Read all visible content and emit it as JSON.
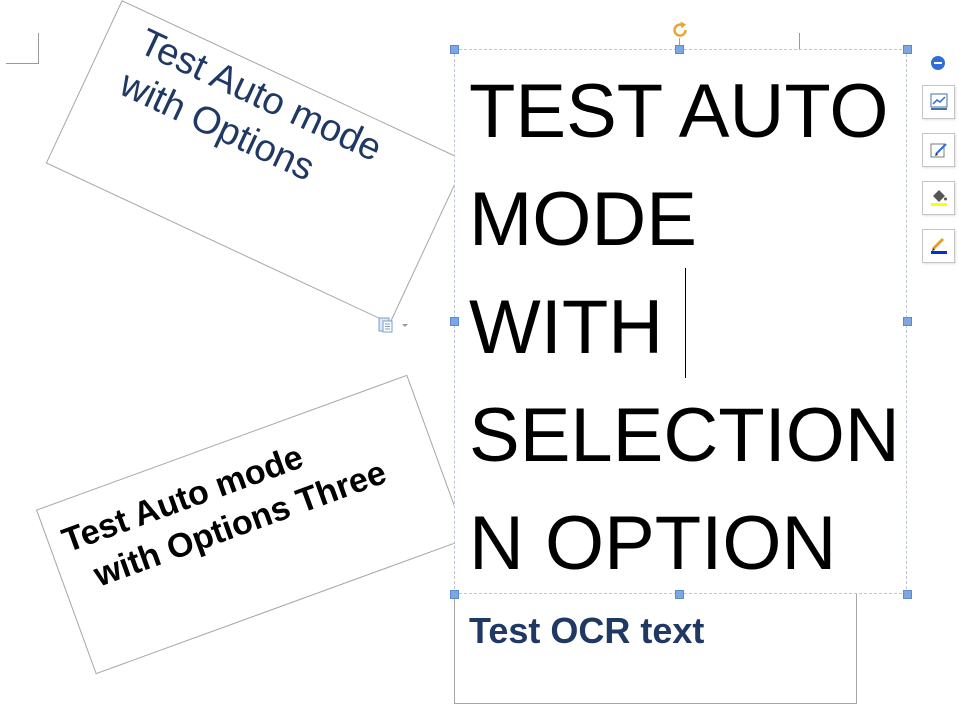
{
  "document": {
    "textbox_rotated_top": {
      "lines": [
        "Test Auto mode",
        "with Options"
      ]
    },
    "textbox_rotated_bottom": {
      "lines": [
        "Test Auto mode",
        "with Options Three"
      ]
    },
    "textbox_selected": {
      "lines": [
        "TEST AUTO",
        "MODE",
        "WITH",
        "SELECTION",
        "N OPTION"
      ]
    },
    "textbox_ocr": {
      "text": "Test OCR text"
    }
  },
  "icons": {
    "rotate_handle": "rotate-icon",
    "layout_options": "paste-options-icon",
    "collapse": "collapse-minus-icon",
    "chart_style": "chart-icon",
    "edit_shape": "edit-shape-icon",
    "fill": "paint-bucket-icon",
    "outline": "pen-outline-icon"
  },
  "colors": {
    "accent_text": "#1f3864",
    "handle": "#7ea6e0",
    "rotate": "#f0a030",
    "fill_indicator": "#ffff00",
    "outline_indicator": "#0033cc"
  }
}
